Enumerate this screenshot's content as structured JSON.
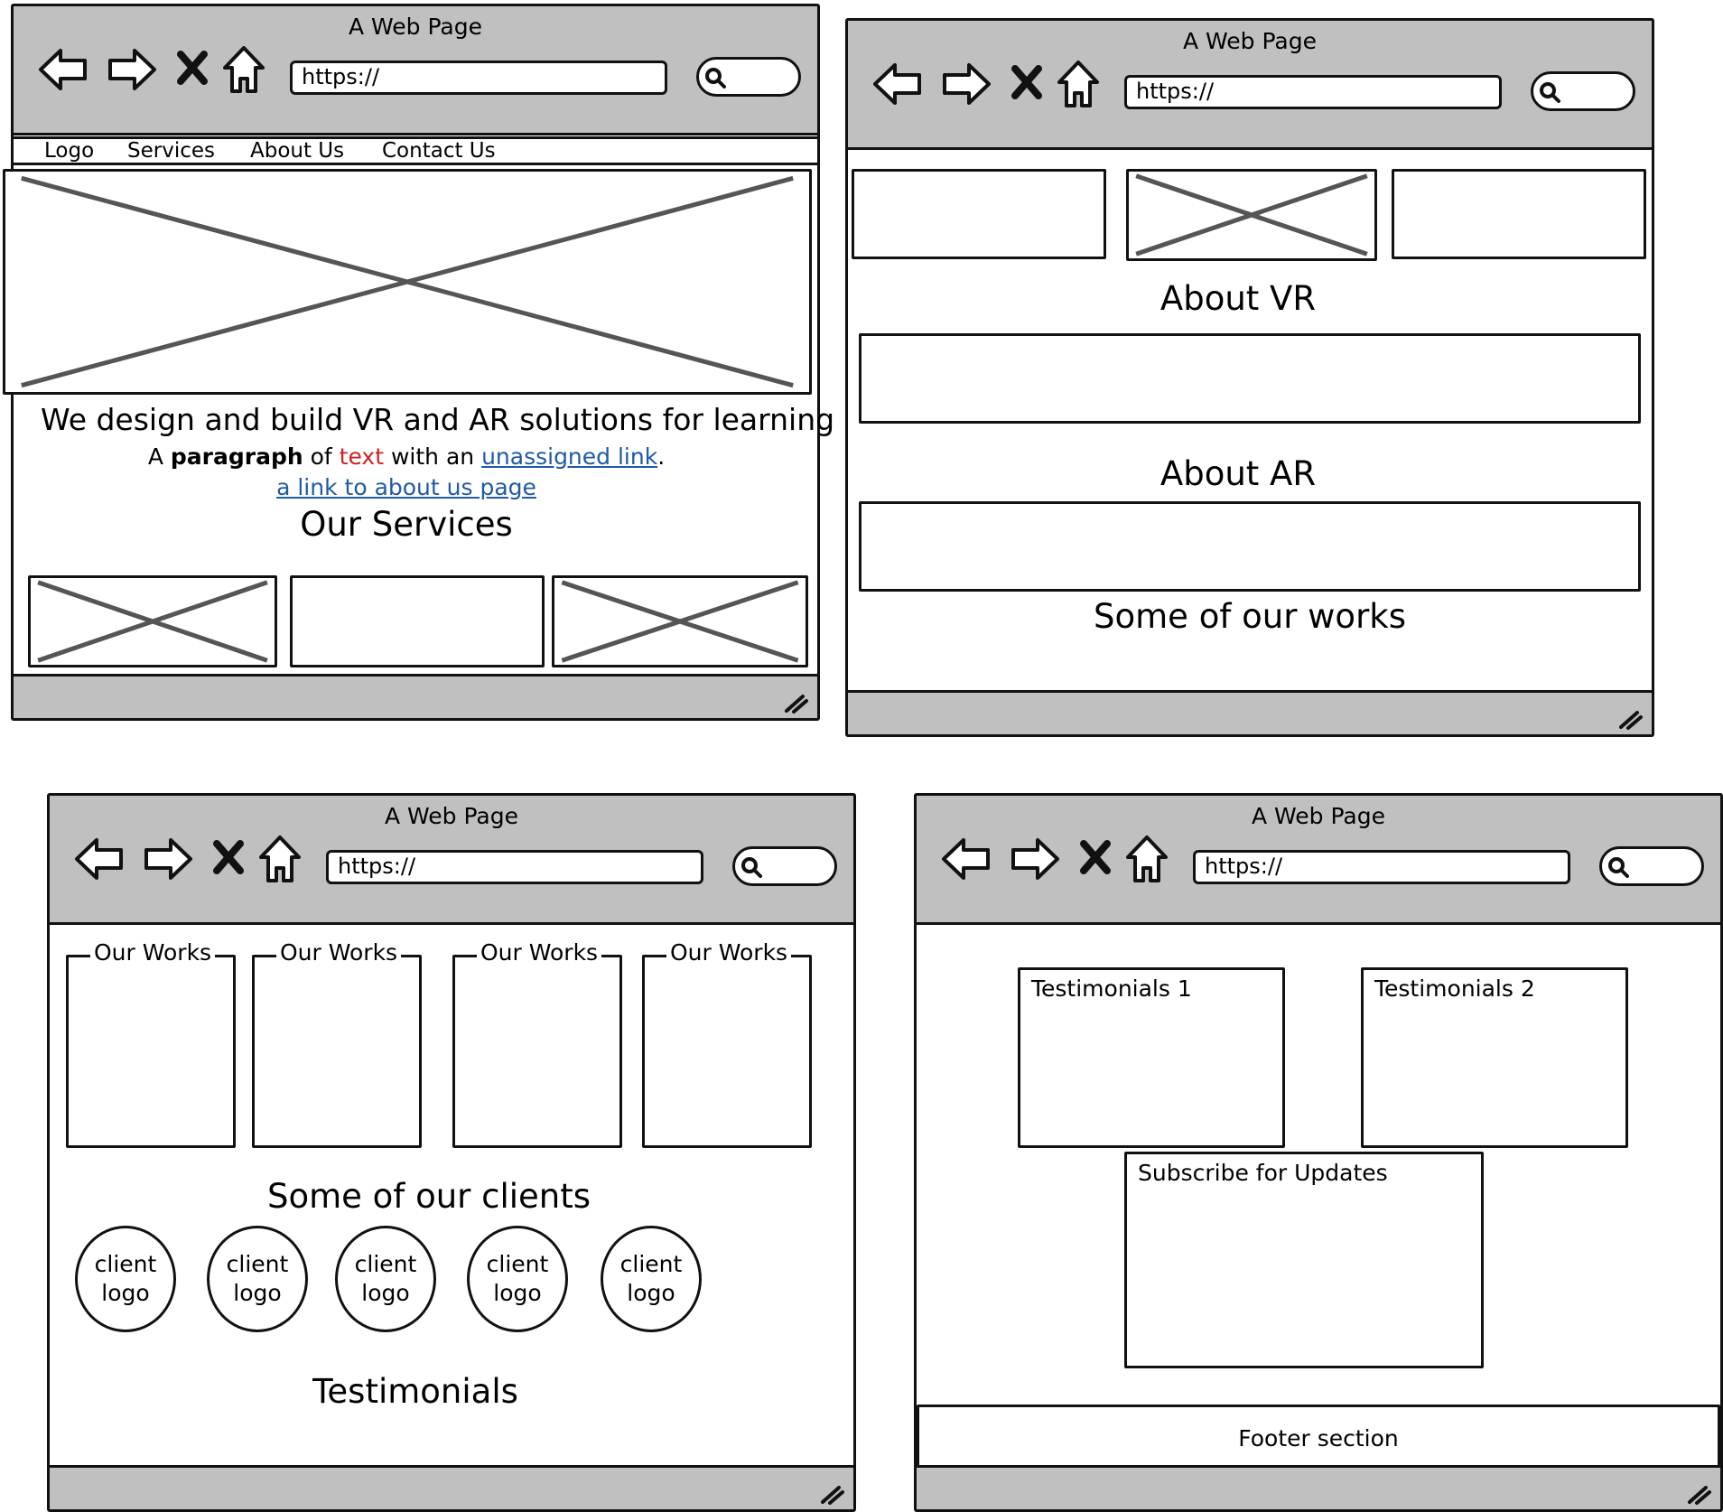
{
  "browser": {
    "title": "A Web Page",
    "url": "https://"
  },
  "mockup1": {
    "nav": [
      "Logo",
      "Services",
      "About Us",
      "Contact Us"
    ],
    "headline": "We design and build VR and AR solutions for learning",
    "paragraph": {
      "prefix": "A ",
      "bold": "paragraph",
      "mid1": " of ",
      "red": "text",
      "mid2": " with an ",
      "link": "unassigned link",
      "suffix": "."
    },
    "about_link": "a link to about us page",
    "services_heading": "Our Services"
  },
  "mockup2": {
    "about_vr": "About VR",
    "about_ar": "About AR",
    "works_heading": "Some of our works"
  },
  "mockup3": {
    "works_label": "Our Works",
    "clients_heading": "Some of our clients",
    "client_logo": [
      "client",
      "logo"
    ],
    "testimonials_heading": "Testimonials"
  },
  "mockup4": {
    "testimonial_1": "Testimonials 1",
    "testimonial_2": "Testimonials 2",
    "subscribe": "Subscribe for Updates",
    "footer": "Footer section"
  }
}
